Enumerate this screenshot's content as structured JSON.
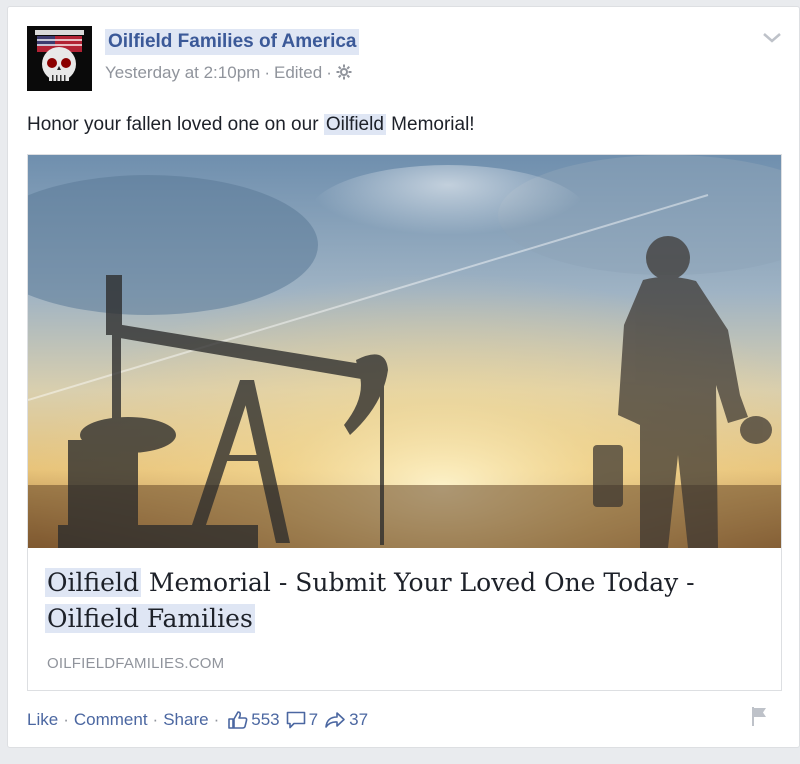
{
  "post": {
    "page_name": "Oilfield Families of America",
    "timestamp": "Yesterday at 2:10pm",
    "edited": "Edited",
    "text_before": "Honor your fallen loved one on our ",
    "text_highlight": "Oilfield",
    "text_after": " Memorial!"
  },
  "link": {
    "title_highlight": "Oilfield",
    "title_mid": " Memorial - Submit Your Loved One Today - ",
    "title_highlight2": "Oilfield Families",
    "domain": "OILFIELDFAMILIES.COM"
  },
  "actions": {
    "like": "Like",
    "comment": "Comment",
    "share": "Share",
    "likes_count": "553",
    "comments_count": "7",
    "shares_count": "37"
  },
  "icons": {
    "gear": "gear-icon",
    "chevron": "chevron-down-icon",
    "thumbs_up": "thumbs-up-icon",
    "comment": "comment-icon",
    "share": "share-arrow-icon",
    "flag": "flag-icon"
  },
  "colors": {
    "link_blue": "#3b5998",
    "action_blue": "#4b67a1",
    "meta_gray": "#90949c",
    "highlight": "#dfe6f4"
  }
}
